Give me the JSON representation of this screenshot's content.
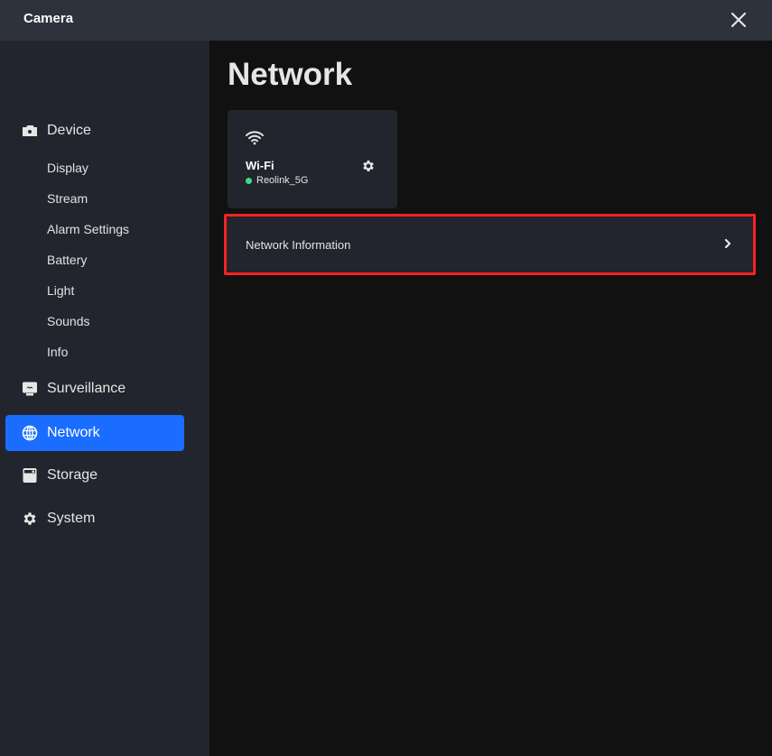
{
  "window": {
    "title": "Camera",
    "close_icon": "close-icon"
  },
  "sidebar": {
    "groups": [
      {
        "label": "Device",
        "icon": "camera-icon",
        "active": false,
        "children": [
          "Display",
          "Stream",
          "Alarm Settings",
          "Battery",
          "Light",
          "Sounds",
          "Info"
        ]
      },
      {
        "label": "Surveillance",
        "icon": "monitor-icon",
        "active": false
      },
      {
        "label": "Network",
        "icon": "globe-icon",
        "active": true
      },
      {
        "label": "Storage",
        "icon": "storage-icon",
        "active": false
      },
      {
        "label": "System",
        "icon": "gear-icon",
        "active": false
      }
    ]
  },
  "main": {
    "page_title": "Network",
    "wifi_card": {
      "icon": "wifi-icon",
      "title": "Wi-Fi",
      "status_color": "#3ddc84",
      "ssid": "Reolink_5G",
      "settings_icon": "gear-icon"
    },
    "network_info_row": {
      "label": "Network Information",
      "icon": "chevron-right-icon",
      "highlighted": true
    }
  },
  "colors": {
    "accent": "#1a6dff",
    "highlight_outline": "#ff2222",
    "connected": "#3ddc84"
  }
}
